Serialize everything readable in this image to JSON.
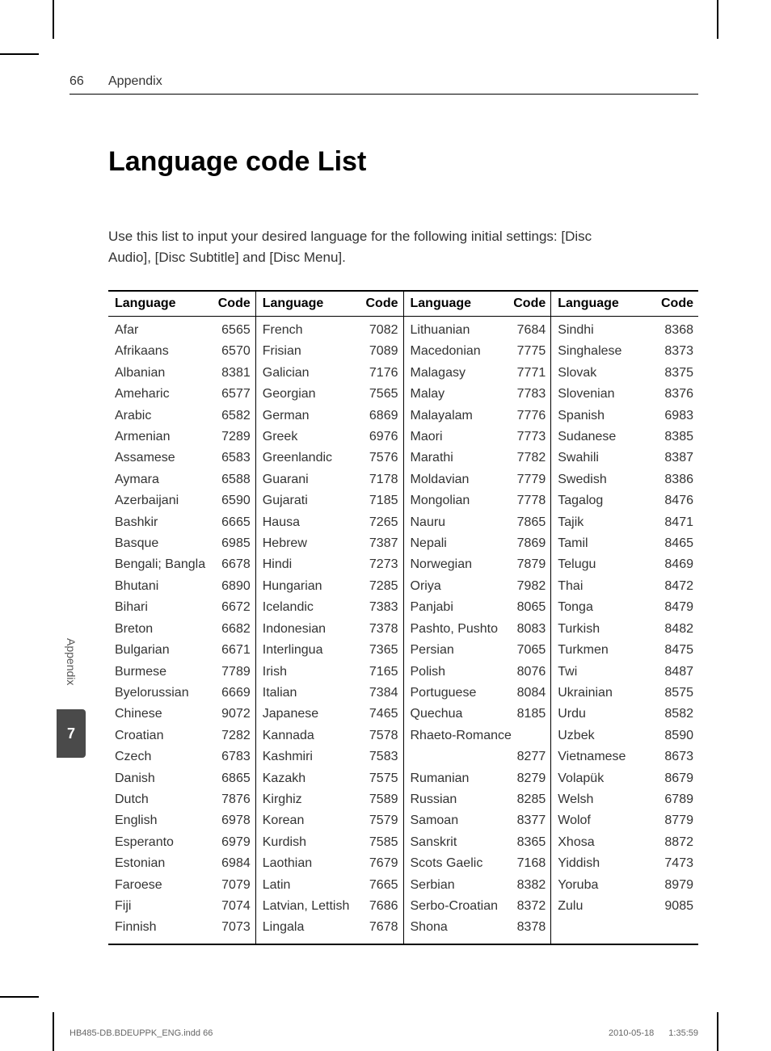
{
  "pageNumber": "66",
  "headerTitle": "Appendix",
  "title": "Language code List",
  "intro": "Use this list to input your desired language for the following initial settings: [Disc Audio], [Disc Subtitle] and [Disc Menu].",
  "colHeaders": {
    "language": "Language",
    "code": "Code"
  },
  "sideTab": {
    "label": "Appendix",
    "number": "7"
  },
  "footer": {
    "left": "HB485-DB.BDEUPPK_ENG.indd   66",
    "date": "2010-05-18",
    "time": "1:35:59"
  },
  "columns": [
    [
      {
        "lang": "Afar",
        "code": "6565"
      },
      {
        "lang": "Afrikaans",
        "code": "6570"
      },
      {
        "lang": "Albanian",
        "code": "8381"
      },
      {
        "lang": "Ameharic",
        "code": "6577"
      },
      {
        "lang": "Arabic",
        "code": "6582"
      },
      {
        "lang": "Armenian",
        "code": "7289"
      },
      {
        "lang": "Assamese",
        "code": "6583"
      },
      {
        "lang": "Aymara",
        "code": "6588"
      },
      {
        "lang": "Azerbaijani",
        "code": "6590"
      },
      {
        "lang": "Bashkir",
        "code": "6665"
      },
      {
        "lang": "Basque",
        "code": "6985"
      },
      {
        "lang": "Bengali; Bangla",
        "code": "6678"
      },
      {
        "lang": "Bhutani",
        "code": "6890"
      },
      {
        "lang": "Bihari",
        "code": "6672"
      },
      {
        "lang": "Breton",
        "code": "6682"
      },
      {
        "lang": "Bulgarian",
        "code": "6671"
      },
      {
        "lang": "Burmese",
        "code": "7789"
      },
      {
        "lang": "Byelorussian",
        "code": "6669"
      },
      {
        "lang": "Chinese",
        "code": "9072"
      },
      {
        "lang": "Croatian",
        "code": "7282"
      },
      {
        "lang": "Czech",
        "code": "6783"
      },
      {
        "lang": "Danish",
        "code": "6865"
      },
      {
        "lang": "Dutch",
        "code": "7876"
      },
      {
        "lang": "English",
        "code": "6978"
      },
      {
        "lang": "Esperanto",
        "code": "6979"
      },
      {
        "lang": "Estonian",
        "code": "6984"
      },
      {
        "lang": "Faroese",
        "code": "7079"
      },
      {
        "lang": "Fiji",
        "code": "7074"
      },
      {
        "lang": "Finnish",
        "code": "7073"
      }
    ],
    [
      {
        "lang": "French",
        "code": "7082"
      },
      {
        "lang": "Frisian",
        "code": "7089"
      },
      {
        "lang": "Galician",
        "code": "7176"
      },
      {
        "lang": "Georgian",
        "code": "7565"
      },
      {
        "lang": "German",
        "code": "6869"
      },
      {
        "lang": "Greek",
        "code": "6976"
      },
      {
        "lang": "Greenlandic",
        "code": "7576"
      },
      {
        "lang": "Guarani",
        "code": "7178"
      },
      {
        "lang": "Gujarati",
        "code": "7185"
      },
      {
        "lang": "Hausa",
        "code": "7265"
      },
      {
        "lang": "Hebrew",
        "code": "7387"
      },
      {
        "lang": "Hindi",
        "code": "7273"
      },
      {
        "lang": "Hungarian",
        "code": "7285"
      },
      {
        "lang": "Icelandic",
        "code": "7383"
      },
      {
        "lang": "Indonesian",
        "code": "7378"
      },
      {
        "lang": "Interlingua",
        "code": "7365"
      },
      {
        "lang": "Irish",
        "code": "7165"
      },
      {
        "lang": "Italian",
        "code": "7384"
      },
      {
        "lang": "Japanese",
        "code": "7465"
      },
      {
        "lang": "Kannada",
        "code": "7578"
      },
      {
        "lang": "Kashmiri",
        "code": "7583"
      },
      {
        "lang": "Kazakh",
        "code": "7575"
      },
      {
        "lang": "Kirghiz",
        "code": "7589"
      },
      {
        "lang": "Korean",
        "code": "7579"
      },
      {
        "lang": "Kurdish",
        "code": "7585"
      },
      {
        "lang": "Laothian",
        "code": "7679"
      },
      {
        "lang": "Latin",
        "code": "7665"
      },
      {
        "lang": "Latvian, Lettish",
        "code": "7686"
      },
      {
        "lang": "Lingala",
        "code": "7678"
      }
    ],
    [
      {
        "lang": "Lithuanian",
        "code": "7684"
      },
      {
        "lang": "Macedonian",
        "code": "7775"
      },
      {
        "lang": "Malagasy",
        "code": "7771"
      },
      {
        "lang": "Malay",
        "code": "7783"
      },
      {
        "lang": "Malayalam",
        "code": "7776"
      },
      {
        "lang": "Maori",
        "code": "7773"
      },
      {
        "lang": "Marathi",
        "code": "7782"
      },
      {
        "lang": "Moldavian",
        "code": "7779"
      },
      {
        "lang": "Mongolian",
        "code": "7778"
      },
      {
        "lang": "Nauru",
        "code": "7865"
      },
      {
        "lang": "Nepali",
        "code": "7869"
      },
      {
        "lang": "Norwegian",
        "code": "7879"
      },
      {
        "lang": "Oriya",
        "code": "7982"
      },
      {
        "lang": "Panjabi",
        "code": "8065"
      },
      {
        "lang": "Pashto, Pushto",
        "code": "8083"
      },
      {
        "lang": "Persian",
        "code": "7065"
      },
      {
        "lang": "Polish",
        "code": "8076"
      },
      {
        "lang": "Portuguese",
        "code": "8084"
      },
      {
        "lang": "Quechua",
        "code": "8185"
      },
      {
        "lang": "Rhaeto-Romance",
        "code": ""
      },
      {
        "lang": "",
        "code": "8277"
      },
      {
        "lang": "Rumanian",
        "code": "8279"
      },
      {
        "lang": "Russian",
        "code": "8285"
      },
      {
        "lang": "Samoan",
        "code": "8377"
      },
      {
        "lang": "Sanskrit",
        "code": "8365"
      },
      {
        "lang": "Scots Gaelic",
        "code": "7168"
      },
      {
        "lang": "Serbian",
        "code": "8382"
      },
      {
        "lang": "Serbo-Croatian",
        "code": "8372"
      },
      {
        "lang": "Shona",
        "code": "8378"
      }
    ],
    [
      {
        "lang": "Sindhi",
        "code": "8368"
      },
      {
        "lang": "Singhalese",
        "code": "8373"
      },
      {
        "lang": "Slovak",
        "code": "8375"
      },
      {
        "lang": "Slovenian",
        "code": "8376"
      },
      {
        "lang": "Spanish",
        "code": "6983"
      },
      {
        "lang": "Sudanese",
        "code": "8385"
      },
      {
        "lang": "Swahili",
        "code": "8387"
      },
      {
        "lang": "Swedish",
        "code": "8386"
      },
      {
        "lang": "Tagalog",
        "code": "8476"
      },
      {
        "lang": "Tajik",
        "code": "8471"
      },
      {
        "lang": "Tamil",
        "code": "8465"
      },
      {
        "lang": "Telugu",
        "code": "8469"
      },
      {
        "lang": "Thai",
        "code": "8472"
      },
      {
        "lang": "Tonga",
        "code": "8479"
      },
      {
        "lang": "Turkish",
        "code": "8482"
      },
      {
        "lang": "Turkmen",
        "code": "8475"
      },
      {
        "lang": "Twi",
        "code": "8487"
      },
      {
        "lang": "Ukrainian",
        "code": "8575"
      },
      {
        "lang": "Urdu",
        "code": "8582"
      },
      {
        "lang": "Uzbek",
        "code": "8590"
      },
      {
        "lang": "Vietnamese",
        "code": "8673"
      },
      {
        "lang": "Volapük",
        "code": "8679"
      },
      {
        "lang": "Welsh",
        "code": "6789"
      },
      {
        "lang": "Wolof",
        "code": "8779"
      },
      {
        "lang": "Xhosa",
        "code": "8872"
      },
      {
        "lang": "Yiddish",
        "code": "7473"
      },
      {
        "lang": "Yoruba",
        "code": "8979"
      },
      {
        "lang": "Zulu",
        "code": "9085"
      }
    ]
  ]
}
